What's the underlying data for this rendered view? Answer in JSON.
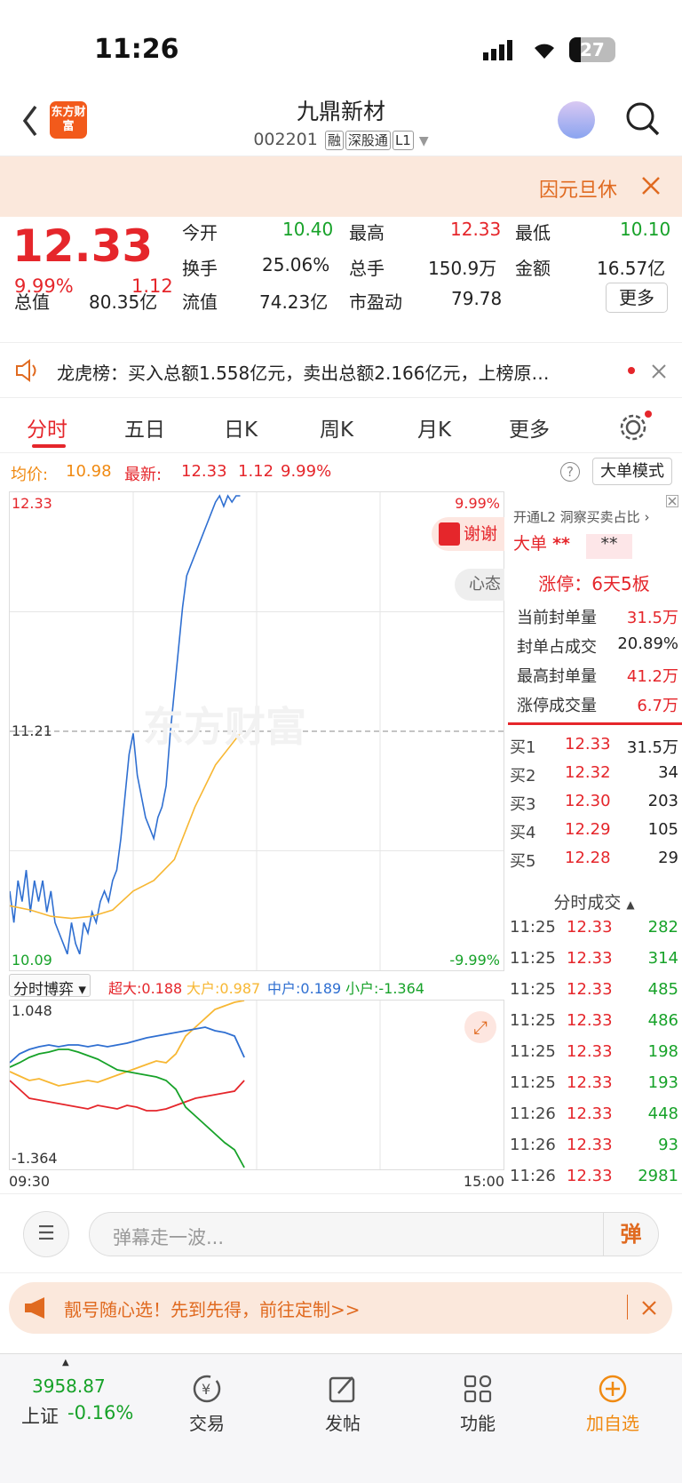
{
  "status": {
    "time": "11:26",
    "battery": "27"
  },
  "header": {
    "logo": "东方财富",
    "name": "九鼎新材",
    "code": "002201",
    "tags": [
      "融",
      "深股通",
      "L1"
    ]
  },
  "notice": {
    "text": "因元旦休"
  },
  "quote": {
    "price": "12.33",
    "pct": "9.99%",
    "chg": "1.12",
    "fields": [
      {
        "label": "今开",
        "value": "10.40",
        "color": "green"
      },
      {
        "label": "最高",
        "value": "12.33",
        "color": "red"
      },
      {
        "label": "最低",
        "value": "10.10",
        "color": "green"
      },
      {
        "label": "换手",
        "value": "25.06%",
        "color": "black"
      },
      {
        "label": "总手",
        "value": "150.9万",
        "color": "black"
      },
      {
        "label": "金额",
        "value": "16.57亿",
        "color": "black"
      },
      {
        "label": "总值",
        "value": "80.35亿",
        "color": "black"
      },
      {
        "label": "流值",
        "value": "74.23亿",
        "color": "black"
      },
      {
        "label": "市盈动",
        "value": "79.78",
        "color": "black"
      }
    ],
    "more": "更多"
  },
  "lhb": {
    "text": "龙虎榜：买入总额1.558亿元，卖出总额2.166亿元，上榜原…"
  },
  "tabs": [
    "分时",
    "五日",
    "日K",
    "周K",
    "月K",
    "更多"
  ],
  "info": {
    "avg_label": "均价:",
    "avg": "10.98",
    "last_label": "最新:",
    "last": "12.33",
    "chg": "1.12",
    "pct": "9.99%",
    "bigorder": "大单模式"
  },
  "chart_data": {
    "type": "line",
    "title": "",
    "xlabel": "",
    "ylabel": "",
    "ylim": [
      10.09,
      12.33
    ],
    "y_tick_labels": [
      "12.33",
      "11.21",
      "10.09"
    ],
    "right_labels": [
      "9.99%",
      "-9.99%"
    ],
    "x_range": [
      0,
      240
    ],
    "x_tick_labels": [
      "09:30",
      "15:00"
    ],
    "series": [
      {
        "color": "#2f6fd1",
        "x": [
          0,
          2,
          4,
          6,
          8,
          10,
          12,
          14,
          16,
          18,
          20,
          22,
          24,
          26,
          28,
          30,
          32,
          34,
          36,
          38,
          40,
          42,
          44,
          46,
          48,
          50,
          52,
          54,
          56,
          58,
          60,
          62,
          64,
          66,
          68,
          70,
          72,
          74,
          76,
          78,
          80,
          82,
          84,
          86,
          88,
          90,
          92,
          94,
          96,
          98,
          100,
          102,
          104,
          106,
          108,
          110,
          112
        ],
        "y": [
          10.45,
          10.3,
          10.5,
          10.4,
          10.55,
          10.35,
          10.5,
          10.4,
          10.5,
          10.35,
          10.45,
          10.3,
          10.25,
          10.2,
          10.15,
          10.3,
          10.2,
          10.15,
          10.3,
          10.25,
          10.35,
          10.3,
          10.4,
          10.45,
          10.4,
          10.5,
          10.55,
          10.7,
          10.9,
          11.1,
          11.2,
          11.0,
          10.9,
          10.8,
          10.75,
          10.7,
          10.8,
          10.85,
          10.95,
          11.2,
          11.4,
          11.6,
          11.8,
          11.95,
          12.0,
          12.05,
          12.1,
          12.15,
          12.2,
          12.25,
          12.3,
          12.33,
          12.28,
          12.33,
          12.3,
          12.33,
          12.33
        ]
      },
      {
        "color": "#f7b733",
        "x": [
          0,
          10,
          20,
          30,
          40,
          50,
          60,
          70,
          80,
          90,
          100,
          112
        ],
        "y": [
          10.38,
          10.36,
          10.33,
          10.32,
          10.33,
          10.36,
          10.45,
          10.5,
          10.6,
          10.85,
          11.05,
          11.2
        ]
      }
    ]
  },
  "game": {
    "label": "分时博弈",
    "items": [
      {
        "t": "超大:0.188",
        "c": "#e5262b"
      },
      {
        "t": "大户:0.987",
        "c": "#f7b733"
      },
      {
        "t": "中户:0.189",
        "c": "#2f6fd1"
      },
      {
        "t": "小户:-1.364",
        "c": "#17a229"
      }
    ],
    "ymax": "1.048",
    "ymin": "-1.364"
  },
  "side": {
    "l2": "开通L2 洞察买卖占比",
    "big": "大单",
    "limit": "涨停：6天5板",
    "stats": [
      {
        "l": "当前封单量",
        "v": "31.5万"
      },
      {
        "l": "封单占成交",
        "v": "20.89%"
      },
      {
        "l": "最高封单量",
        "v": "41.2万"
      },
      {
        "l": "涨停成交量",
        "v": "6.7万"
      }
    ],
    "bids": [
      {
        "l": "买1",
        "p": "12.33",
        "v": "31.5万"
      },
      {
        "l": "买2",
        "p": "12.32",
        "v": "34"
      },
      {
        "l": "买3",
        "p": "12.30",
        "v": "203"
      },
      {
        "l": "买4",
        "p": "12.29",
        "v": "105"
      },
      {
        "l": "买5",
        "p": "12.28",
        "v": "29"
      }
    ],
    "ticks_title": "分时成交",
    "ticks": [
      {
        "t": "11:25",
        "p": "12.33",
        "v": "282"
      },
      {
        "t": "11:25",
        "p": "12.33",
        "v": "314"
      },
      {
        "t": "11:25",
        "p": "12.33",
        "v": "485"
      },
      {
        "t": "11:25",
        "p": "12.33",
        "v": "486"
      },
      {
        "t": "11:25",
        "p": "12.33",
        "v": "198"
      },
      {
        "t": "11:25",
        "p": "12.33",
        "v": "193"
      },
      {
        "t": "11:26",
        "p": "12.33",
        "v": "448"
      },
      {
        "t": "11:26",
        "p": "12.33",
        "v": "93"
      },
      {
        "t": "11:26",
        "p": "12.33",
        "v": "2981"
      }
    ],
    "thanks": "谢谢",
    "heart": "心态"
  },
  "danmu": {
    "placeholder": "弹幕走一波...",
    "btn": "弹"
  },
  "ad": {
    "text": "靓号随心选！先到先得，前往定制>>"
  },
  "nav": {
    "index_val": "3958.87",
    "index_name": "上证",
    "index_pct": "-0.16%",
    "items": [
      "交易",
      "发帖",
      "功能",
      "加自选"
    ]
  }
}
